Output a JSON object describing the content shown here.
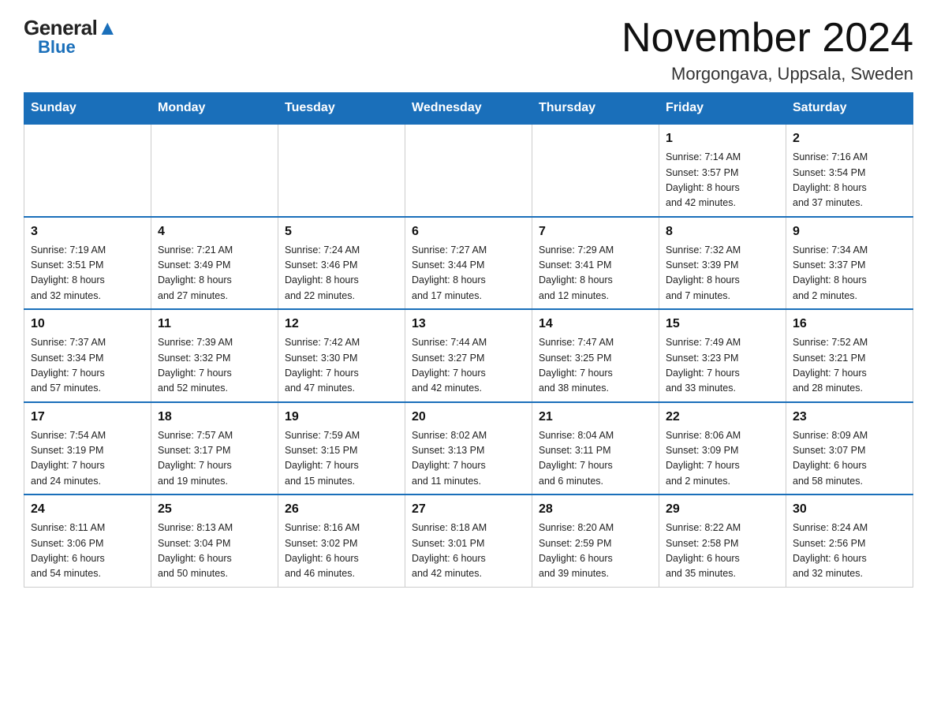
{
  "header": {
    "logo_general": "General",
    "logo_blue": "Blue",
    "month_title": "November 2024",
    "location": "Morgongava, Uppsala, Sweden"
  },
  "days_of_week": [
    "Sunday",
    "Monday",
    "Tuesday",
    "Wednesday",
    "Thursday",
    "Friday",
    "Saturday"
  ],
  "weeks": [
    [
      {
        "day": "",
        "info": ""
      },
      {
        "day": "",
        "info": ""
      },
      {
        "day": "",
        "info": ""
      },
      {
        "day": "",
        "info": ""
      },
      {
        "day": "",
        "info": ""
      },
      {
        "day": "1",
        "info": "Sunrise: 7:14 AM\nSunset: 3:57 PM\nDaylight: 8 hours\nand 42 minutes."
      },
      {
        "day": "2",
        "info": "Sunrise: 7:16 AM\nSunset: 3:54 PM\nDaylight: 8 hours\nand 37 minutes."
      }
    ],
    [
      {
        "day": "3",
        "info": "Sunrise: 7:19 AM\nSunset: 3:51 PM\nDaylight: 8 hours\nand 32 minutes."
      },
      {
        "day": "4",
        "info": "Sunrise: 7:21 AM\nSunset: 3:49 PM\nDaylight: 8 hours\nand 27 minutes."
      },
      {
        "day": "5",
        "info": "Sunrise: 7:24 AM\nSunset: 3:46 PM\nDaylight: 8 hours\nand 22 minutes."
      },
      {
        "day": "6",
        "info": "Sunrise: 7:27 AM\nSunset: 3:44 PM\nDaylight: 8 hours\nand 17 minutes."
      },
      {
        "day": "7",
        "info": "Sunrise: 7:29 AM\nSunset: 3:41 PM\nDaylight: 8 hours\nand 12 minutes."
      },
      {
        "day": "8",
        "info": "Sunrise: 7:32 AM\nSunset: 3:39 PM\nDaylight: 8 hours\nand 7 minutes."
      },
      {
        "day": "9",
        "info": "Sunrise: 7:34 AM\nSunset: 3:37 PM\nDaylight: 8 hours\nand 2 minutes."
      }
    ],
    [
      {
        "day": "10",
        "info": "Sunrise: 7:37 AM\nSunset: 3:34 PM\nDaylight: 7 hours\nand 57 minutes."
      },
      {
        "day": "11",
        "info": "Sunrise: 7:39 AM\nSunset: 3:32 PM\nDaylight: 7 hours\nand 52 minutes."
      },
      {
        "day": "12",
        "info": "Sunrise: 7:42 AM\nSunset: 3:30 PM\nDaylight: 7 hours\nand 47 minutes."
      },
      {
        "day": "13",
        "info": "Sunrise: 7:44 AM\nSunset: 3:27 PM\nDaylight: 7 hours\nand 42 minutes."
      },
      {
        "day": "14",
        "info": "Sunrise: 7:47 AM\nSunset: 3:25 PM\nDaylight: 7 hours\nand 38 minutes."
      },
      {
        "day": "15",
        "info": "Sunrise: 7:49 AM\nSunset: 3:23 PM\nDaylight: 7 hours\nand 33 minutes."
      },
      {
        "day": "16",
        "info": "Sunrise: 7:52 AM\nSunset: 3:21 PM\nDaylight: 7 hours\nand 28 minutes."
      }
    ],
    [
      {
        "day": "17",
        "info": "Sunrise: 7:54 AM\nSunset: 3:19 PM\nDaylight: 7 hours\nand 24 minutes."
      },
      {
        "day": "18",
        "info": "Sunrise: 7:57 AM\nSunset: 3:17 PM\nDaylight: 7 hours\nand 19 minutes."
      },
      {
        "day": "19",
        "info": "Sunrise: 7:59 AM\nSunset: 3:15 PM\nDaylight: 7 hours\nand 15 minutes."
      },
      {
        "day": "20",
        "info": "Sunrise: 8:02 AM\nSunset: 3:13 PM\nDaylight: 7 hours\nand 11 minutes."
      },
      {
        "day": "21",
        "info": "Sunrise: 8:04 AM\nSunset: 3:11 PM\nDaylight: 7 hours\nand 6 minutes."
      },
      {
        "day": "22",
        "info": "Sunrise: 8:06 AM\nSunset: 3:09 PM\nDaylight: 7 hours\nand 2 minutes."
      },
      {
        "day": "23",
        "info": "Sunrise: 8:09 AM\nSunset: 3:07 PM\nDaylight: 6 hours\nand 58 minutes."
      }
    ],
    [
      {
        "day": "24",
        "info": "Sunrise: 8:11 AM\nSunset: 3:06 PM\nDaylight: 6 hours\nand 54 minutes."
      },
      {
        "day": "25",
        "info": "Sunrise: 8:13 AM\nSunset: 3:04 PM\nDaylight: 6 hours\nand 50 minutes."
      },
      {
        "day": "26",
        "info": "Sunrise: 8:16 AM\nSunset: 3:02 PM\nDaylight: 6 hours\nand 46 minutes."
      },
      {
        "day": "27",
        "info": "Sunrise: 8:18 AM\nSunset: 3:01 PM\nDaylight: 6 hours\nand 42 minutes."
      },
      {
        "day": "28",
        "info": "Sunrise: 8:20 AM\nSunset: 2:59 PM\nDaylight: 6 hours\nand 39 minutes."
      },
      {
        "day": "29",
        "info": "Sunrise: 8:22 AM\nSunset: 2:58 PM\nDaylight: 6 hours\nand 35 minutes."
      },
      {
        "day": "30",
        "info": "Sunrise: 8:24 AM\nSunset: 2:56 PM\nDaylight: 6 hours\nand 32 minutes."
      }
    ]
  ]
}
